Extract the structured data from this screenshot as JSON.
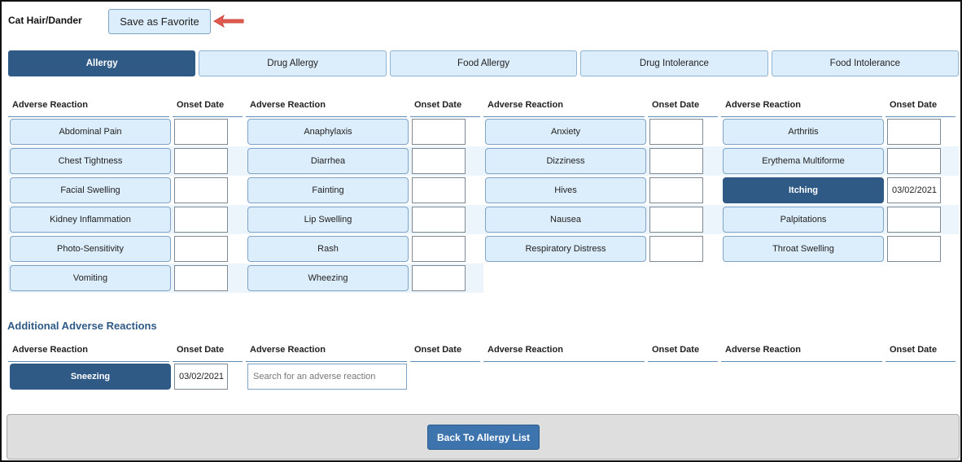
{
  "header": {
    "title": "Cat Hair/Dander",
    "favorite_label": "Save as Favorite"
  },
  "tabs": [
    {
      "label": "Allergy",
      "active": true
    },
    {
      "label": "Drug Allergy",
      "active": false
    },
    {
      "label": "Food Allergy",
      "active": false
    },
    {
      "label": "Drug Intolerance",
      "active": false
    },
    {
      "label": "Food Intolerance",
      "active": false
    }
  ],
  "columns": {
    "reaction": "Adverse Reaction",
    "onset": "Onset Date"
  },
  "reactions": [
    [
      {
        "label": "Abdominal Pain",
        "date": "",
        "selected": false
      },
      {
        "label": "Anaphylaxis",
        "date": "",
        "selected": false
      },
      {
        "label": "Anxiety",
        "date": "",
        "selected": false
      },
      {
        "label": "Arthritis",
        "date": "",
        "selected": false
      }
    ],
    [
      {
        "label": "Chest Tightness",
        "date": "",
        "selected": false
      },
      {
        "label": "Diarrhea",
        "date": "",
        "selected": false
      },
      {
        "label": "Dizziness",
        "date": "",
        "selected": false
      },
      {
        "label": "Erythema Multiforme",
        "date": "",
        "selected": false
      }
    ],
    [
      {
        "label": "Facial Swelling",
        "date": "",
        "selected": false
      },
      {
        "label": "Fainting",
        "date": "",
        "selected": false
      },
      {
        "label": "Hives",
        "date": "",
        "selected": false
      },
      {
        "label": "Itching",
        "date": "03/02/2021",
        "selected": true
      }
    ],
    [
      {
        "label": "Kidney Inflammation",
        "date": "",
        "selected": false
      },
      {
        "label": "Lip Swelling",
        "date": "",
        "selected": false
      },
      {
        "label": "Nausea",
        "date": "",
        "selected": false
      },
      {
        "label": "Palpitations",
        "date": "",
        "selected": false
      }
    ],
    [
      {
        "label": "Photo-Sensitivity",
        "date": "",
        "selected": false
      },
      {
        "label": "Rash",
        "date": "",
        "selected": false
      },
      {
        "label": "Respiratory Distress",
        "date": "",
        "selected": false
      },
      {
        "label": "Throat Swelling",
        "date": "",
        "selected": false
      }
    ],
    [
      {
        "label": "Vomiting",
        "date": "",
        "selected": false
      },
      {
        "label": "Wheezing",
        "date": "",
        "selected": false
      }
    ]
  ],
  "additional": {
    "title": "Additional Adverse Reactions",
    "items": [
      {
        "label": "Sneezing",
        "date": "03/02/2021",
        "selected": true
      }
    ],
    "search_placeholder": "Search for an adverse reaction"
  },
  "footer": {
    "back_label": "Back To Allergy List"
  },
  "colors": {
    "selected": "#2f5a85",
    "button_bg": "#dcedfb",
    "accent_arrow": "#e05a50"
  },
  "icons": {
    "pointer": "arrow-left-icon"
  }
}
